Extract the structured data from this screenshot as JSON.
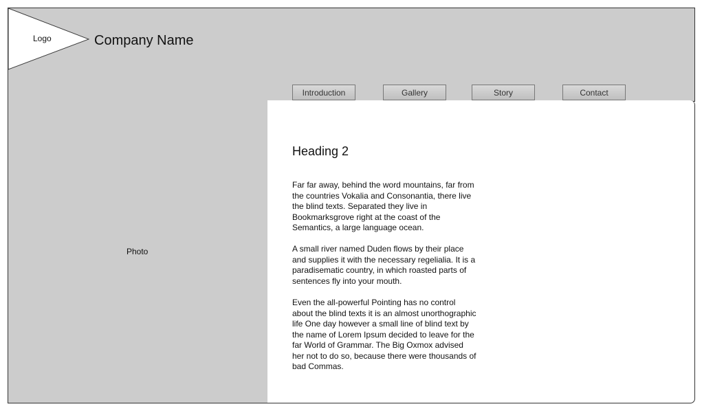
{
  "header": {
    "logo_label": "Logo",
    "company_name": "Company Name"
  },
  "nav": {
    "items": [
      {
        "label": "Introduction"
      },
      {
        "label": "Gallery"
      },
      {
        "label": "Story"
      },
      {
        "label": "Contact"
      }
    ]
  },
  "photo": {
    "label": "Photo"
  },
  "main": {
    "heading": "Heading 2",
    "paragraphs": [
      "Far far away, behind the word mountains, far from the countries Vokalia and Consonantia, there live the blind texts. Separated they live in Bookmarksgrove right at the coast of the Semantics, a large language ocean.",
      "A small river named Duden flows by their place and supplies it with the necessary regelialia. It is a paradisematic country, in which roasted parts of sentences fly into your mouth.",
      "Even the all-powerful Pointing has no control about the blind texts it is an almost unorthographic life One day however a small line of blind text by the name of Lorem Ipsum decided to leave for the far World of Grammar. The Big Oxmox advised her not to do so, because there were thousands of bad Commas."
    ]
  },
  "colors": {
    "panel_gray": "#cccccc",
    "border": "#333333"
  }
}
